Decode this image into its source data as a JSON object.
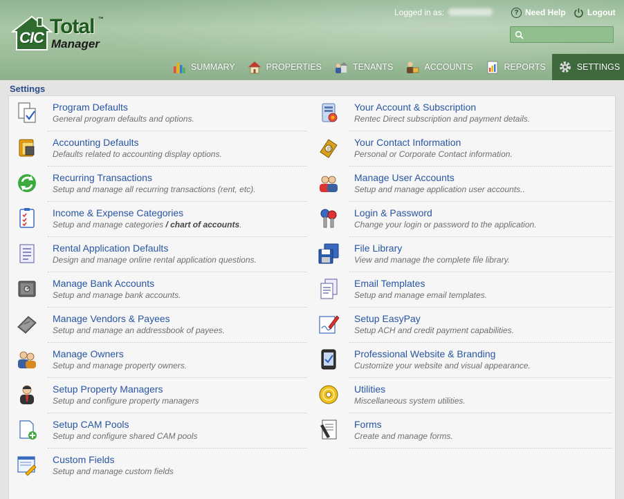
{
  "header": {
    "logo": {
      "cic": "CIC",
      "total": "Total",
      "manager": "Manager",
      "tm": "™"
    },
    "logged_in_label": "Logged in as:",
    "need_help": "Need Help",
    "logout": "Logout",
    "search": {
      "placeholder": "",
      "value": ""
    }
  },
  "nav": [
    {
      "label": "SUMMARY",
      "icon": "bar-chart-icon",
      "active": false
    },
    {
      "label": "PROPERTIES",
      "icon": "house-icon",
      "active": false
    },
    {
      "label": "TENANTS",
      "icon": "people-house-icon",
      "active": false
    },
    {
      "label": "ACCOUNTS",
      "icon": "accounts-icon",
      "active": false
    },
    {
      "label": "REPORTS",
      "icon": "report-icon",
      "active": false
    },
    {
      "label": "SETTINGS",
      "icon": "gear-icon",
      "active": true
    }
  ],
  "page_title": "Settings",
  "settings_left": [
    {
      "title": "Program Defaults",
      "desc": "General program defaults and options.",
      "icon": "document-check-icon"
    },
    {
      "title": "Accounting Defaults",
      "desc": "Defaults related to accounting display options.",
      "icon": "ledger-icon"
    },
    {
      "title": "Recurring Transactions",
      "desc": "Setup and manage all recurring transactions (rent, etc).",
      "icon": "recycle-icon"
    },
    {
      "title": "Income & Expense Categories",
      "desc_plain": "Setup and manage categories ",
      "desc_bold": "/ chart of accounts",
      "desc_end": ".",
      "icon": "checklist-icon"
    },
    {
      "title": "Rental Application Defaults",
      "desc": "Design and manage online rental application questions.",
      "icon": "form-list-icon"
    },
    {
      "title": "Manage Bank Accounts",
      "desc": "Setup and manage bank accounts.",
      "icon": "safe-icon"
    },
    {
      "title": "Manage Vendors & Payees",
      "desc": "Setup and manage an addressbook of payees.",
      "icon": "address-book-icon"
    },
    {
      "title": "Manage Owners",
      "desc": "Setup and manage property owners.",
      "icon": "owners-icon"
    },
    {
      "title": "Setup Property Managers",
      "desc": "Setup and configure property managers",
      "icon": "manager-icon"
    },
    {
      "title": "Setup CAM Pools",
      "desc": "Setup and configure shared CAM pools",
      "icon": "document-add-icon"
    },
    {
      "title": "Custom Fields",
      "desc": "Setup and manage custom fields",
      "icon": "form-edit-icon"
    }
  ],
  "settings_right": [
    {
      "title": "Your Account & Subscription",
      "desc": "Rentec Direct subscription and payment details.",
      "icon": "server-icon"
    },
    {
      "title": "Your Contact Information",
      "desc": "Personal or Corporate Contact information.",
      "icon": "contact-book-icon"
    },
    {
      "title": "Manage User Accounts",
      "desc": "Setup and manage application user accounts..",
      "icon": "users-icon"
    },
    {
      "title": "Login & Password",
      "desc": "Change your login or password to the application.",
      "icon": "keys-icon"
    },
    {
      "title": "File Library",
      "desc": "View and manage the complete file library.",
      "icon": "floppy-icon"
    },
    {
      "title": "Email Templates",
      "desc": "Setup and manage email templates.",
      "icon": "documents-icon"
    },
    {
      "title": "Setup EasyPay",
      "desc": "Setup ACH and credit payment capabilities.",
      "icon": "sign-icon"
    },
    {
      "title": "Professional Website & Branding",
      "desc": "Customize your website and visual appearance.",
      "icon": "tablet-icon"
    },
    {
      "title": "Utilities",
      "desc": "Miscellaneous system utilities.",
      "icon": "disc-icon"
    },
    {
      "title": "Forms",
      "desc": "Create and manage forms.",
      "icon": "forms-icon"
    }
  ]
}
